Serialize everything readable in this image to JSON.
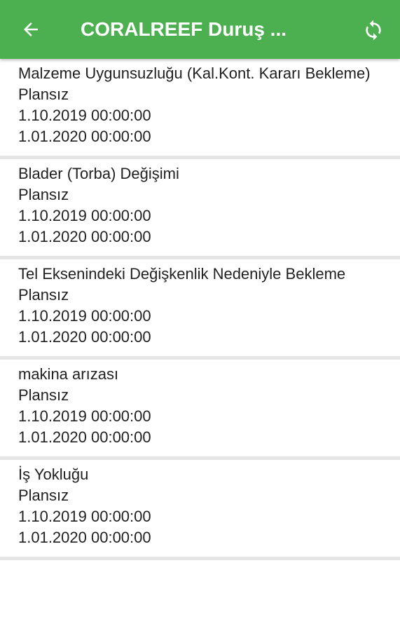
{
  "header": {
    "title": "CORALREEF Duruş ...",
    "back_icon": "arrow-left-icon",
    "refresh_icon": "refresh-icon",
    "background": "#4caf50"
  },
  "items": [
    {
      "reason": "Malzeme Uygunsuzluğu (Kal.Kont. Kararı Bekleme)",
      "type": "Plansız",
      "start": "1.10.2019 00:00:00",
      "end": "1.01.2020 00:00:00"
    },
    {
      "reason": "Blader (Torba) Değişimi",
      "type": "Plansız",
      "start": "1.10.2019 00:00:00",
      "end": "1.01.2020 00:00:00"
    },
    {
      "reason": "Tel Eksenindeki Değişkenlik Nedeniyle Bekleme",
      "type": "Plansız",
      "start": "1.10.2019 00:00:00",
      "end": "1.01.2020 00:00:00"
    },
    {
      "reason": "makina arızası",
      "type": "Plansız",
      "start": "1.10.2019 00:00:00",
      "end": "1.01.2020 00:00:00"
    },
    {
      "reason": "İş Yokluğu",
      "type": "Plansız",
      "start": "1.10.2019 00:00:00",
      "end": "1.01.2020 00:00:00"
    }
  ]
}
